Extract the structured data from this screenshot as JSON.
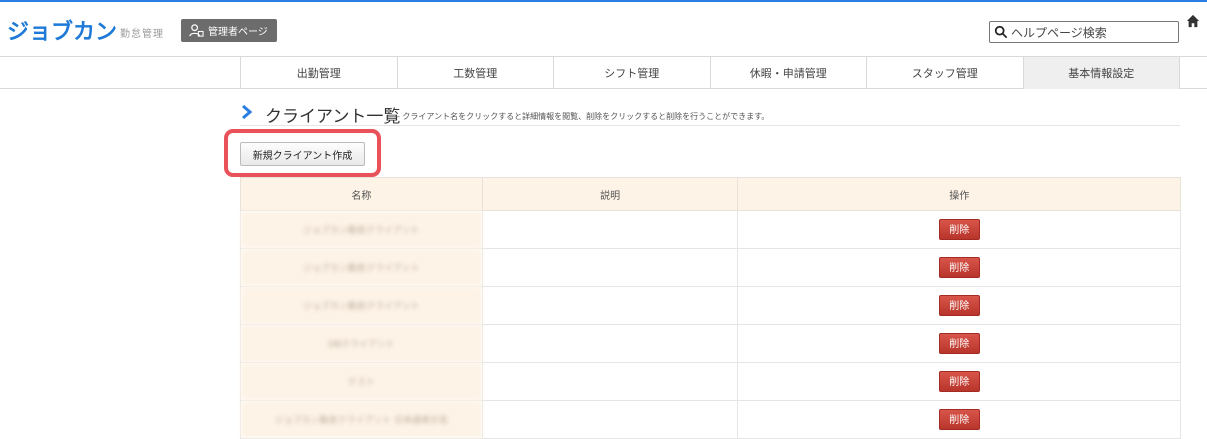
{
  "header": {
    "logo": "ジョブカン",
    "logo_sub": "勤怠管理",
    "admin_label": "管理者ページ",
    "search_placeholder": "ヘルプページ検索"
  },
  "nav": {
    "items": [
      "出勤管理",
      "工数管理",
      "シフト管理",
      "休暇・申請管理",
      "スタッフ管理",
      "基本情報設定"
    ]
  },
  "page": {
    "title": "クライアント一覧",
    "description": "- クライアント名をクリックすると詳細情報を閲覧、削除をクリックすると削除を行うことができます。",
    "new_button": "新規クライアント作成"
  },
  "table": {
    "headers": [
      "名称",
      "説明",
      "操作"
    ],
    "rows": [
      {
        "name": "ジョブカン勤怠クライアント",
        "desc": "",
        "action": "削除"
      },
      {
        "name": "ジョブカン勤怠クライアント",
        "desc": "",
        "action": "削除"
      },
      {
        "name": "ジョブカン勤怠クライアント",
        "desc": "",
        "action": "削除"
      },
      {
        "name": "DBクライアント",
        "desc": "",
        "action": "削除"
      },
      {
        "name": "テスト",
        "desc": "",
        "action": "削除"
      },
      {
        "name": "ジョブカン勤怠クライアント 日本語表示名",
        "desc": "",
        "action": "削除"
      }
    ]
  },
  "colors": {
    "brand": "#1e7ad6",
    "highlight": "#e9525a",
    "delete": "#c8443a"
  }
}
